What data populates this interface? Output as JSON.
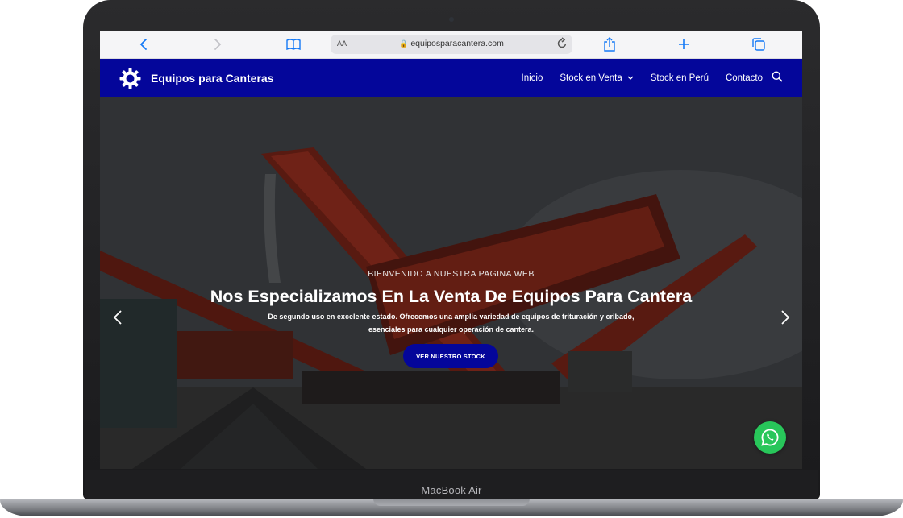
{
  "device": {
    "label": "MacBook Air"
  },
  "browser": {
    "address": "equiposparacantera.com",
    "text_size_label": "AA",
    "icons": [
      "back-chevron-icon",
      "forward-chevron-icon",
      "book-icon",
      "lock-icon",
      "reload-icon",
      "share-icon",
      "plus-icon",
      "tabs-icon"
    ],
    "accent": "#1479f6"
  },
  "site": {
    "brand": "Equipos para Canteras",
    "nav_color": "#04069a",
    "menu": [
      {
        "label": "Inicio"
      },
      {
        "label": "Stock en Venta"
      },
      {
        "label": "Stock en Perú"
      },
      {
        "label": "Contacto"
      }
    ]
  },
  "hero": {
    "kicker": "BIENVENIDO A NUESTRA PAGINA WEB",
    "headline": "Nos Especializamos En La Venta De Equipos Para Cantera",
    "subtext_line1": "De segundo uso en excelente estado. Ofrecemos una amplia variedad de equipos de trituración y cribado,",
    "subtext_line2": "esenciales para cualquier operación de cantera.",
    "cta": "VER NUESTRO STOCK",
    "whatsapp_color": "#28c65a"
  }
}
